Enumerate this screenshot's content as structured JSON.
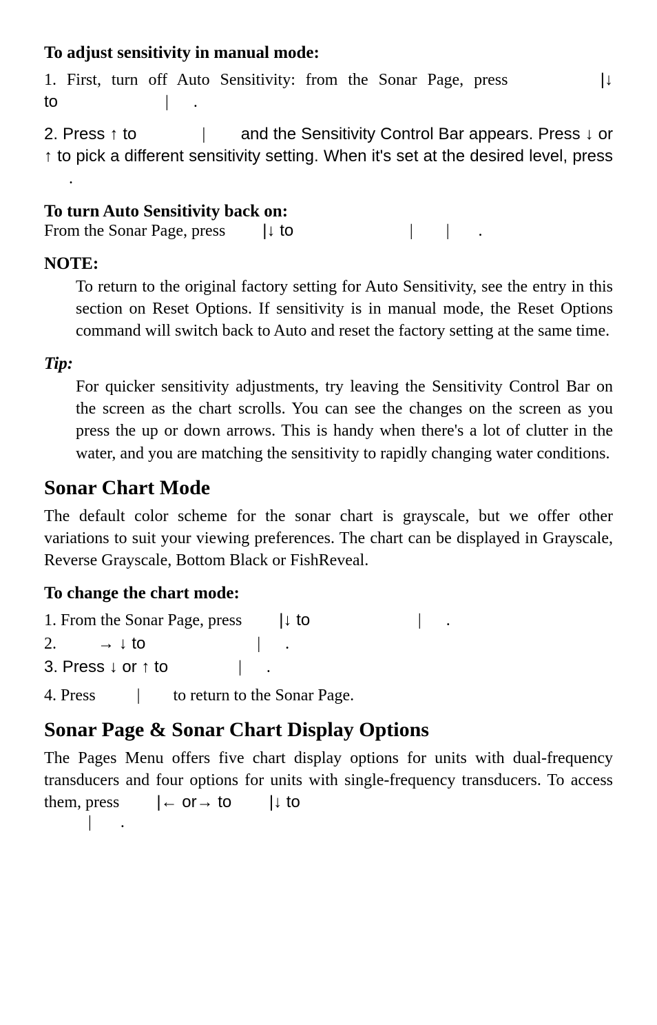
{
  "doc": {
    "adjust": {
      "heading": "To adjust sensitivity in manual mode:",
      "step1a": "1. First, turn off Auto Sensitivity: from the Sonar Page, press ",
      "step1b": "|↓ to",
      "step1c": " |",
      "step1d": ".",
      "step2a": "2. Press ↑ to",
      "step2b": " | ",
      "step2c": " and the Sensitivity Control Bar appears. Press ↓ or ↑ to pick a different sensitivity setting. When it's set at the desired level, press ",
      "step2d": "."
    },
    "autoback": {
      "heading": "To turn Auto Sensitivity back on:",
      "line_a": "From the Sonar Page, press ",
      "line_b": "|↓ to ",
      "line_c": " | ",
      "line_d": " | ",
      "line_e": "."
    },
    "note": {
      "heading": "NOTE:",
      "body": "To return to the original factory setting for Auto Sensitivity, see the entry in this section on Reset Options. If sensitivity is in manual mode, the Reset Options command will switch back to Auto and reset the factory setting at the same time."
    },
    "tip": {
      "heading": "Tip:",
      "body": "For quicker sensitivity adjustments, try leaving the Sensitivity Control Bar on the screen as the chart scrolls. You can see the changes on the screen as you press the up or down arrows. This is handy when there's a lot of clutter in the water, and you are matching the sensitivity to rapidly changing water conditions."
    },
    "chartmode": {
      "heading": "Sonar Chart Mode",
      "body": "The default color scheme for the sonar chart is grayscale, but we offer other variations to suit your viewing preferences. The chart can be displayed in Grayscale, Reverse Grayscale, Bottom Black or FishReveal."
    },
    "changechart": {
      "heading": "To change the chart mode:",
      "s1a": "1. From the Sonar Page, press ",
      "s1b": "|↓ to ",
      "s1c": " | ",
      "s1d": ".",
      "s2a": "2.",
      "s2b": "→ ↓ to",
      "s2c": " | ",
      "s2d": ".",
      "s3a": "3. Press ↓ or ↑ to",
      "s3b": " | ",
      "s3c": ".",
      "s4a": "4. Press ",
      "s4b": " | ",
      "s4c": " to return to the Sonar Page."
    },
    "pagedisp": {
      "heading": "Sonar Page & Sonar Chart Display Options",
      "body_a": "The Pages Menu offers five chart display options for units with dual-frequency transducers and four options for units with single-frequency transducers. To access them, press ",
      "body_b": "|← or→ to ",
      "body_c": "|↓ to",
      "body_d": " | ",
      "body_e": "."
    }
  }
}
